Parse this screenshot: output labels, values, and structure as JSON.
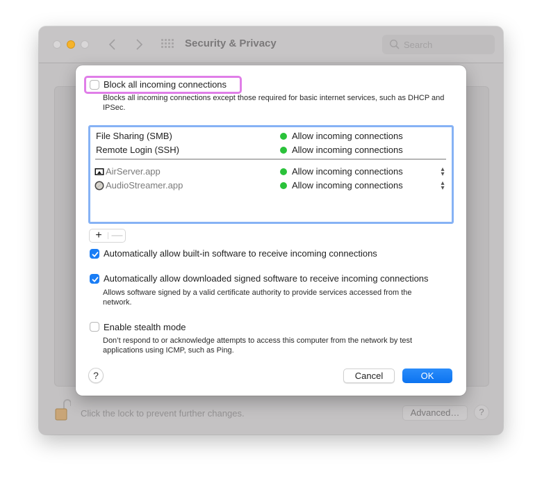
{
  "window": {
    "title": "Security & Privacy",
    "search_placeholder": "Search",
    "footer_text": "Click the lock to prevent further changes.",
    "advanced_label": "Advanced…",
    "help_label": "?"
  },
  "sheet": {
    "block_all": {
      "label": "Block all incoming connections",
      "checked": false,
      "description": "Blocks all incoming connections except those required for basic internet services, such as DHCP and IPSec."
    },
    "services": [
      {
        "name": "File Sharing (SMB)",
        "status": "Allow incoming connections",
        "status_color": "#2ac23a"
      },
      {
        "name": "Remote Login (SSH)",
        "status": "Allow incoming connections",
        "status_color": "#2ac23a"
      }
    ],
    "apps": [
      {
        "name": "AirServer.app",
        "icon": "airplay-icon",
        "status": "Allow incoming connections",
        "status_color": "#2ac23a"
      },
      {
        "name": "AudioStreamer.app",
        "icon": "app-circle-icon",
        "status": "Allow incoming connections",
        "status_color": "#2ac23a"
      }
    ],
    "add_label": "+",
    "remove_label": "—",
    "auto_builtin": {
      "label": "Automatically allow built-in software to receive incoming connections",
      "checked": true
    },
    "auto_signed": {
      "label": "Automatically allow downloaded signed software to receive incoming connections",
      "checked": true,
      "description": "Allows software signed by a valid certificate authority to provide services accessed from the network."
    },
    "stealth": {
      "label": "Enable stealth mode",
      "checked": false,
      "description": "Don’t respond to or acknowledge attempts to access this computer from the network by test applications using ICMP, such as Ping."
    },
    "help_label": "?",
    "cancel_label": "Cancel",
    "ok_label": "OK"
  },
  "colors": {
    "accent": "#1a7df5",
    "highlight": "#e07ee8",
    "status_green": "#2ac23a"
  }
}
